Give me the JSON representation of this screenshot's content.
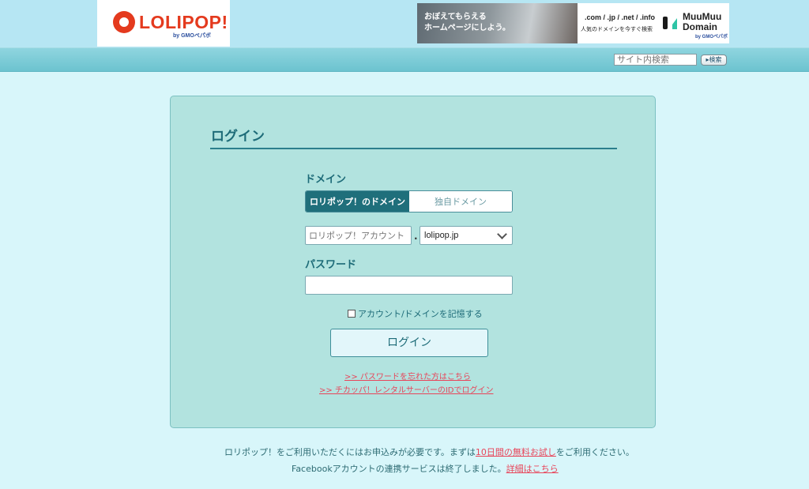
{
  "header": {
    "logo_text": "LOLIPOP!",
    "logo_sub": "by GMOペパボ",
    "banner": {
      "headline_1": "おぼえてもらえる",
      "headline_2": "ホームページにしよう。",
      "tlds": ".com / .jp / .net / .info",
      "sub": "人気のドメインを今すぐ検索",
      "brand_1": "MuuMuu",
      "brand_2": "Domain",
      "brand_sub": "by GMOペパボ"
    }
  },
  "nav": {
    "search_placeholder": "サイト内検索",
    "search_button": "▸検索"
  },
  "login": {
    "title": "ログイン",
    "domain_label": "ドメイン",
    "tabs": [
      {
        "label": "ロリポップ！のドメイン",
        "active": true
      },
      {
        "label": "独自ドメイン",
        "active": false
      }
    ],
    "account_placeholder": "ロリポップ！アカウント",
    "separator": ".",
    "domain_select_value": "lolipop.jp",
    "password_label": "パスワード",
    "password_value": "",
    "remember_label": "アカウント/ドメインを記憶する",
    "remember_checked": false,
    "submit_label": "ログイン",
    "forgot_link": ">>  パスワードを忘れた方はこちら",
    "chicappa_link": ">>  チカッパ！レンタルサーバーのIDでログイン"
  },
  "footer": {
    "line1_pre": "ロリポップ！をご利用いただくにはお申込みが必要です。まずは",
    "line1_link": "10日間の無料お試し",
    "line1_post": "をご利用ください。",
    "line2_pre": "Facebookアカウントの連携サービスは終了しました。",
    "line2_link": "詳細はこちら"
  },
  "colors": {
    "brand_red": "#e43a1e",
    "accent_teal": "#1f6f7b",
    "panel_bg": "#b2e3df",
    "link_red": "#e8455a"
  }
}
